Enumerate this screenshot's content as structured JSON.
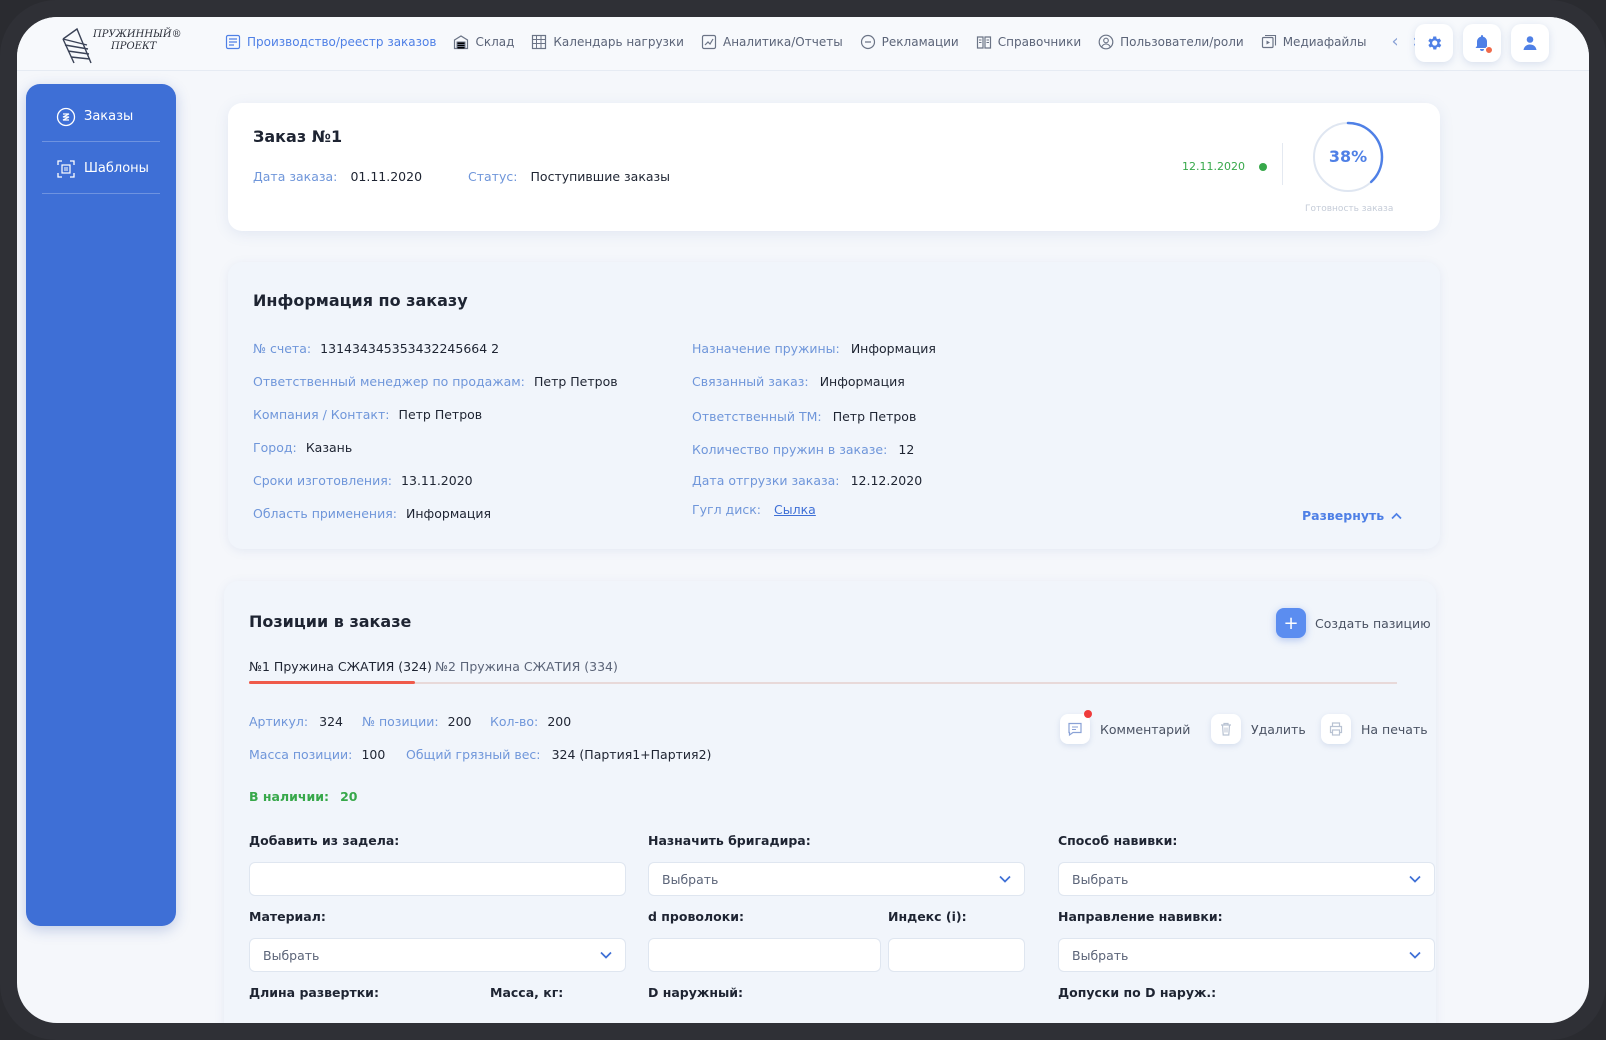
{
  "brand": {
    "logo_line1": "ПРУЖИННЫЙ®",
    "logo_line2": "ПРОЕКТ"
  },
  "nav": {
    "items": [
      {
        "label": "Производство/реестр заказов",
        "icon": "register-icon",
        "active": true
      },
      {
        "label": "Склад",
        "icon": "warehouse-icon"
      },
      {
        "label": "Календарь нагрузки",
        "icon": "calendar-grid-icon"
      },
      {
        "label": "Аналитика/Отчеты",
        "icon": "chart-icon"
      },
      {
        "label": "Рекламации",
        "icon": "minus-circle-icon"
      },
      {
        "label": "Справочники",
        "icon": "book-icon"
      },
      {
        "label": "Пользователи/роли",
        "icon": "user-circle-icon"
      },
      {
        "label": "Медиафайлы",
        "icon": "media-icon"
      }
    ],
    "prev": "‹",
    "next": "›"
  },
  "sidebar": {
    "items": [
      {
        "label": "Заказы",
        "icon": "orders-icon"
      },
      {
        "label": "Шаблоны",
        "icon": "templates-icon"
      }
    ]
  },
  "order": {
    "title": "Заказ №1",
    "date_label": "Дата заказа:",
    "date_value": "01.11.2020",
    "status_label": "Статус:",
    "status_value": "Поступившие заказы",
    "deadline": "12.11.2020",
    "progress_text": "38%",
    "progress": 0.38,
    "progress_caption": "Готовность заказа"
  },
  "info": {
    "title": "Информация по заказу",
    "left": [
      {
        "label": "№ счета:",
        "value": "131434345353432245664 2"
      },
      {
        "label": "Ответственный менеджер по продажам:",
        "value": "Петр Петров"
      },
      {
        "label": "Компания / Контакт:",
        "value": "Петр Петров"
      },
      {
        "label": "Город:",
        "value": "Казань"
      },
      {
        "label": "Сроки изготовления:",
        "value": "13.11.2020"
      },
      {
        "label": "Область применения:",
        "value": "Информация"
      }
    ],
    "right": [
      {
        "label": "Назначение пружины:",
        "value": "Информация"
      },
      {
        "label": "Связанный заказ:",
        "value": "Информация"
      },
      {
        "label": "Ответственный ТМ:",
        "value": "Петр Петров"
      },
      {
        "label": "Количество пружин в заказе:",
        "value": "12"
      },
      {
        "label": "Дата отгрузки заказа:",
        "value": "12.12.2020"
      }
    ],
    "gdisk_label": "Гугл диск:",
    "gdisk_link": "Сылка",
    "expand": "Развернуть"
  },
  "positions": {
    "title": "Позиции в заказе",
    "create": "Создать пазицию",
    "tabs": [
      "№1 Пружина СЖАТИЯ (324)",
      "№2 Пружина СЖАТИЯ (334)"
    ],
    "article_label": "Артикул:",
    "article_value": "324",
    "posno_label": "№ позиции:",
    "posno_value": "200",
    "qty_label": "Кол-во:",
    "qty_value": "200",
    "mass_label": "Масса позиции:",
    "mass_value": "100",
    "gross_label": "Общий грязный вес:",
    "gross_value": "324 (Партия1+Партия2)",
    "stock_label": "В наличии:",
    "stock_value": "20",
    "actions": {
      "comment": "Комментарий",
      "delete": "Удалить",
      "print": "На печать"
    },
    "fields": {
      "backlog": {
        "label": "Добавить из задела:",
        "value": ""
      },
      "foreman": {
        "label": "Назначить бригадира:",
        "value": "Выбрать"
      },
      "winding_method": {
        "label": "Способ навивки:",
        "value": "Выбрать"
      },
      "material": {
        "label": "Материал:",
        "value": "Выбрать"
      },
      "wire_d": {
        "label": "d проволоки:",
        "value": ""
      },
      "index": {
        "label": "Индекс (i):",
        "value": ""
      },
      "winding_dir": {
        "label": "Направление навивки:",
        "value": "Выбрать"
      },
      "unroll_len": {
        "label": "Длина развертки:"
      },
      "mass_kg": {
        "label": "Масса, кг:"
      },
      "d_outer": {
        "label": "D наружный:"
      },
      "tol_d_outer": {
        "label": "Допуски по D наруж.:"
      }
    }
  },
  "colors": {
    "accent": "#3e6fd6",
    "label": "#6f96da",
    "success": "#37a84a",
    "danger": "#ef5a4a"
  }
}
